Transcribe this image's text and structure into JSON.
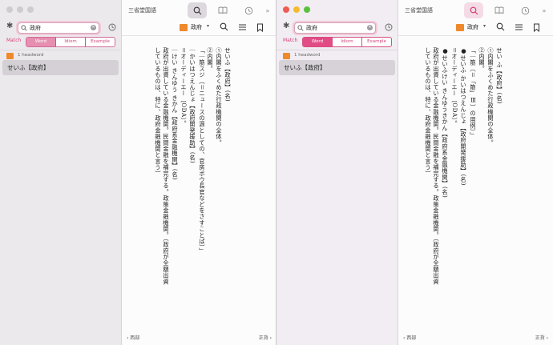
{
  "app_title": "三省堂国語",
  "search": {
    "query": "政府"
  },
  "match": {
    "label": "Match",
    "tabs": [
      "Word",
      "Idiom",
      "Example"
    ],
    "selected": "Word"
  },
  "headword_count": "1 headword",
  "result": "せいふ【政府】",
  "main_toolbar": {
    "dict_title": "政府",
    "caret": "▾"
  },
  "nav": {
    "prev": "‹ 西部",
    "next": "正貨 ›"
  },
  "entry": {
    "left": [
      {
        "text": "せいふ【政府】(名)",
        "cls": "bold"
      },
      {
        "text": "①内閣をふくめた行政機関の全体。",
        "cls": ""
      },
      {
        "text": "②内閣。",
        "cls": ""
      },
      {
        "text": "「｜筋スジ〔＝ニュースの源としての、官房ボウ長官などをさすことば〕」",
        "cls": ""
      },
      {
        "text": "｜かいはつえんじょ【政府開発援助】(名)",
        "cls": "bold"
      },
      {
        "text": "＝オーディーエー〔ODA〕。",
        "cls": "blue"
      },
      {
        "text": "｜けい きんゆう きかん【政府系金融機関】(名)",
        "cls": "bold"
      },
      {
        "text": "政府が出資している金融機関。民間金融を補完する。政策金融機関。〔政府が全額出資",
        "cls": ""
      },
      {
        "text": "しているものは、特に、政府金融機関と言う〕",
        "cls": ""
      }
    ],
    "right": [
      {
        "text": "せい ふ【政府】(名)",
        "cls": "bold"
      },
      {
        "text": "①内閣をふくめた行政機関の全体。",
        "cls": ""
      },
      {
        "text": "②内閣。",
        "cls": ""
      },
      {
        "text": "「｜筋〔＝「筋」Ⅲ〕の用例〕」",
        "cls": ""
      },
      {
        "text": "●せいふ かいはつえんじょ【政府開発援助】(名)",
        "cls": "bold"
      },
      {
        "text": "＝オーディーエー〔ODA〕。",
        "cls": "blue"
      },
      {
        "text": "●せいふけい きんゆうきかん【政府系金融機関】(名)",
        "cls": "bold"
      },
      {
        "text": "政府が出資している金融機関。民間金融を補完する。政策金融機関。〔政府が全額出資",
        "cls": ""
      },
      {
        "text": "しているものは、特に、政府金融機関と言う〕",
        "cls": ""
      }
    ]
  }
}
